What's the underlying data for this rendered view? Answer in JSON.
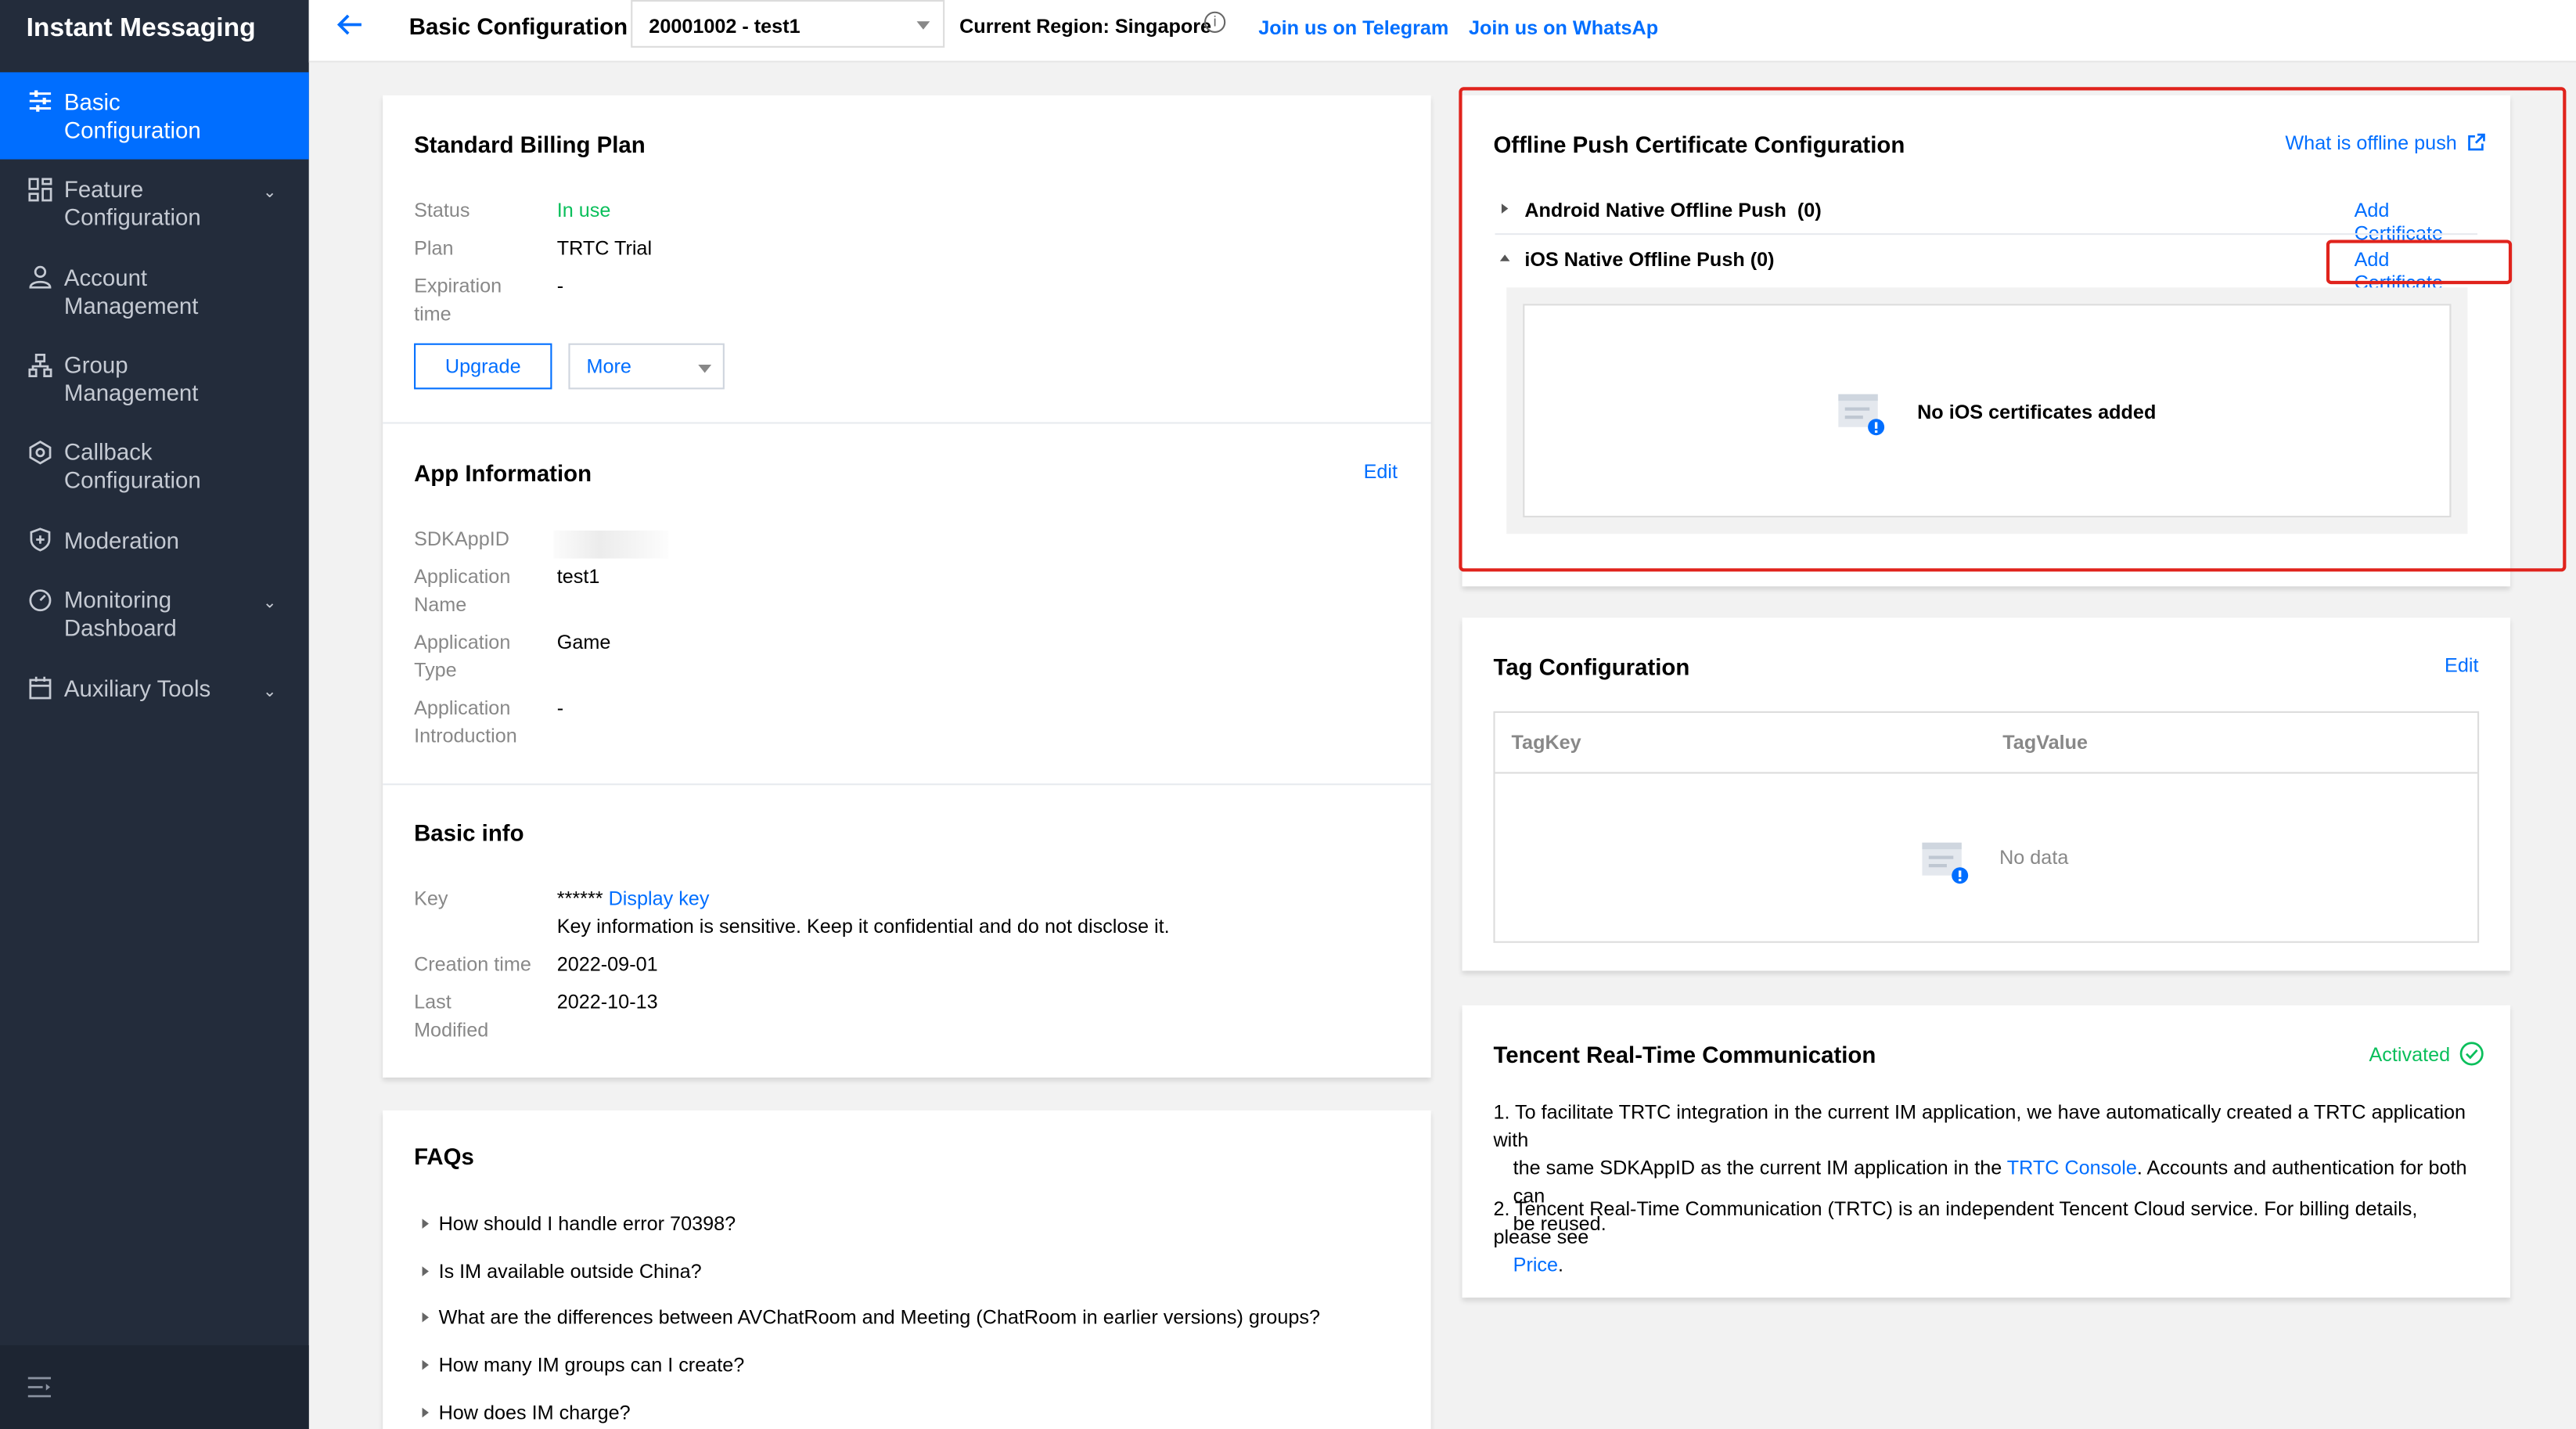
{
  "sidebar": {
    "brand": "Instant Messaging",
    "items": [
      {
        "label_1": "Basic",
        "label_2": "Configuration",
        "icon": "sliders-icon",
        "active": true
      },
      {
        "label_1": "Feature",
        "label_2": "Configuration",
        "icon": "grid-icon",
        "chevron": true
      },
      {
        "label_1": "Account",
        "label_2": "Management",
        "icon": "user-icon"
      },
      {
        "label_1": "Group",
        "label_2": "Management",
        "icon": "group-icon"
      },
      {
        "label_1": "Callback",
        "label_2": "Configuration",
        "icon": "hexagon-icon"
      },
      {
        "label_1": "Moderation",
        "icon": "shield-icon"
      },
      {
        "label_1": "Monitoring",
        "label_2": "Dashboard",
        "icon": "gauge-icon",
        "chevron": true
      },
      {
        "label_1": "Auxiliary Tools",
        "icon": "calendar-icon",
        "chevron": true
      }
    ]
  },
  "topbar": {
    "title": "Basic Configuration",
    "app_select": "20001002 - test1",
    "region": "Current Region: Singapore",
    "telegram": "Join us on Telegram",
    "whatsapp": "Join us on WhatsApp"
  },
  "billing": {
    "title": "Standard Billing Plan",
    "status_label": "Status",
    "status_value": "In use",
    "plan_label": "Plan",
    "plan_value": "TRTC Trial",
    "expiration_label_1": "Expiration",
    "expiration_label_2": "time",
    "expiration_value": "-",
    "upgrade_button": "Upgrade",
    "more_button": "More"
  },
  "app_info": {
    "title": "App Information",
    "edit": "Edit",
    "sdkappid_label": "SDKAppID",
    "name_label_1": "Application",
    "name_label_2": "Name",
    "name_value": "test1",
    "type_label_1": "Application",
    "type_label_2": "Type",
    "type_value": "Game",
    "intro_label_1": "Application",
    "intro_label_2": "Introduction",
    "intro_value": "-"
  },
  "basic_info": {
    "title": "Basic info",
    "key_label": "Key",
    "key_mask": "******",
    "display_key": "Display key",
    "key_note": "Key information is sensitive. Keep it confidential and do not disclose it.",
    "created_label": "Creation time",
    "created_value": "2022-09-01",
    "modified_label_1": "Last",
    "modified_label_2": "Modified",
    "modified_value": "2022-10-13"
  },
  "faqs": {
    "title": "FAQs",
    "items": [
      "How should I handle error 70398?",
      "Is IM available outside China?",
      "What are the differences between AVChatRoom and Meeting (ChatRoom in earlier versions) groups?",
      "How many IM groups can I create?",
      "How does IM charge?"
    ]
  },
  "offline_push": {
    "title": "Offline Push Certificate Configuration",
    "what_link": "What is offline push",
    "android_label": "Android Native Offline Push",
    "android_count": "(0)",
    "ios_label": "iOS Native Offline Push",
    "ios_count": "(0)",
    "add_certificate": "Add Certificate",
    "ios_empty": "No iOS certificates added"
  },
  "tags": {
    "title": "Tag Configuration",
    "edit": "Edit",
    "col_key": "TagKey",
    "col_value": "TagValue",
    "empty": "No data"
  },
  "trtc": {
    "title": "Tencent Real-Time Communication",
    "status": "Activated",
    "p1_a": "1. To facilitate TRTC integration in the current IM application, we have automatically created a TRTC application with",
    "p1_b": "the same SDKAppID as the current IM application in the ",
    "p1_link": "TRTC Console",
    "p1_c": ". Accounts and authentication for both can",
    "p1_d": "be reused.",
    "p2_a": "2. Tencent Real-Time Communication (TRTC) is an independent Tencent Cloud service. For billing details, please see",
    "p2_link": "Price",
    "p2_end": "."
  },
  "colors": {
    "accent": "#006eff",
    "sidebar": "#232c3b",
    "success": "#0abf5b",
    "highlight": "#e0231c"
  }
}
